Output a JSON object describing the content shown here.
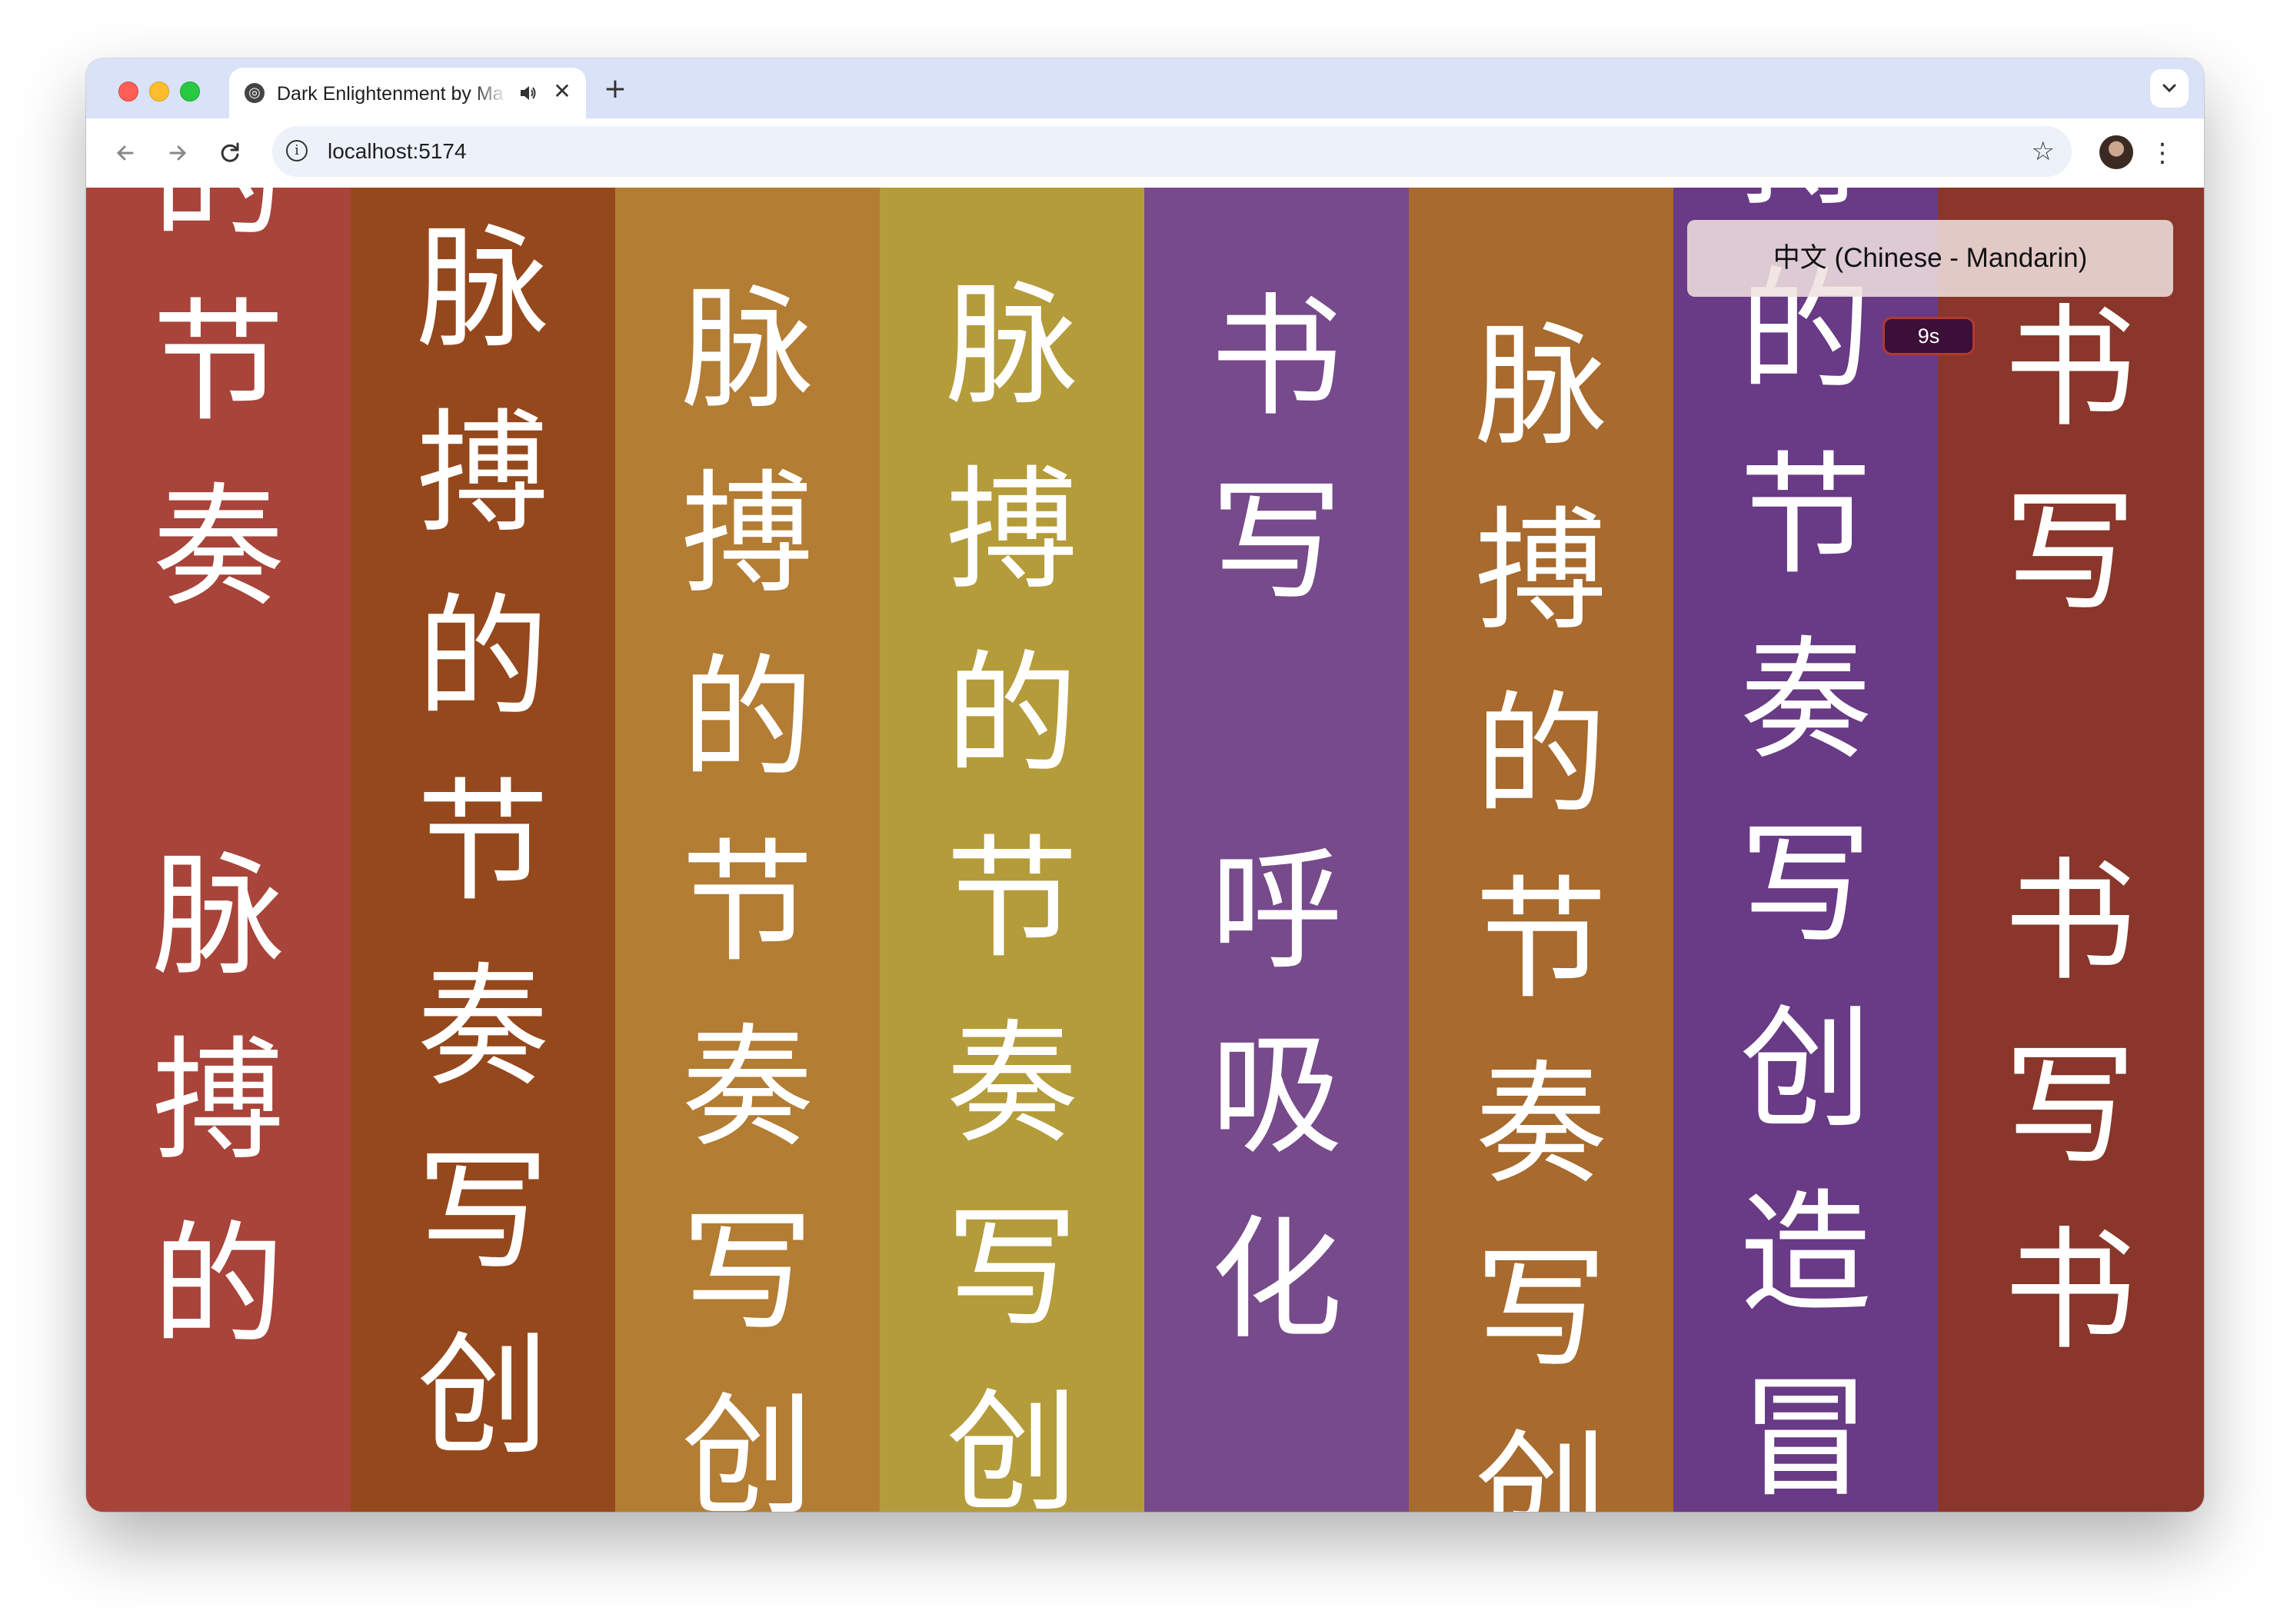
{
  "browser": {
    "tab_title": "Dark Enlightenment by Ma",
    "tab_favicon": "globe-icon",
    "tab_close": "✕",
    "new_tab": "+",
    "url": "localhost:5174",
    "icons": [
      "back-icon",
      "forward-icon",
      "reload-icon",
      "info-icon",
      "star-icon",
      "avatar",
      "more-icon",
      "tab-search-icon",
      "speaker-icon"
    ]
  },
  "app": {
    "language_select": "中文 (Chinese - Mandarin)",
    "timer": "9s",
    "columns": [
      {
        "color": "#a9443a",
        "text": "的\n节\n奏\n\n脉\n搏\n的",
        "offset_lines": -0.55
      },
      {
        "color": "#96481d",
        "text": "脉\n搏\n的\n节\n奏\n写\n创",
        "offset_lines": 0.05
      },
      {
        "color": "#b47d34",
        "text": "脉\n搏\n的\n节\n奏\n写\n创",
        "offset_lines": 0.38
      },
      {
        "color": "#b59c3a",
        "text": "脉\n搏\n的\n节\n奏\n写\n创",
        "offset_lines": 0.36
      },
      {
        "color": "#774a8c",
        "text": "书\n写\n\n呼\n吸\n化",
        "offset_lines": 0.42
      },
      {
        "color": "#a86a2d",
        "text": "脉\n搏\n的\n节\n奏\n写\n创",
        "offset_lines": 0.58
      },
      {
        "color": "#693a86",
        "text": "搏\n的\n节\n奏\n写\n创\n造\n冒",
        "offset_lines": -0.72
      },
      {
        "color": "#8a362a",
        "text": "书\n写\n\n书\n写\n书",
        "offset_lines": 0.48
      }
    ]
  }
}
